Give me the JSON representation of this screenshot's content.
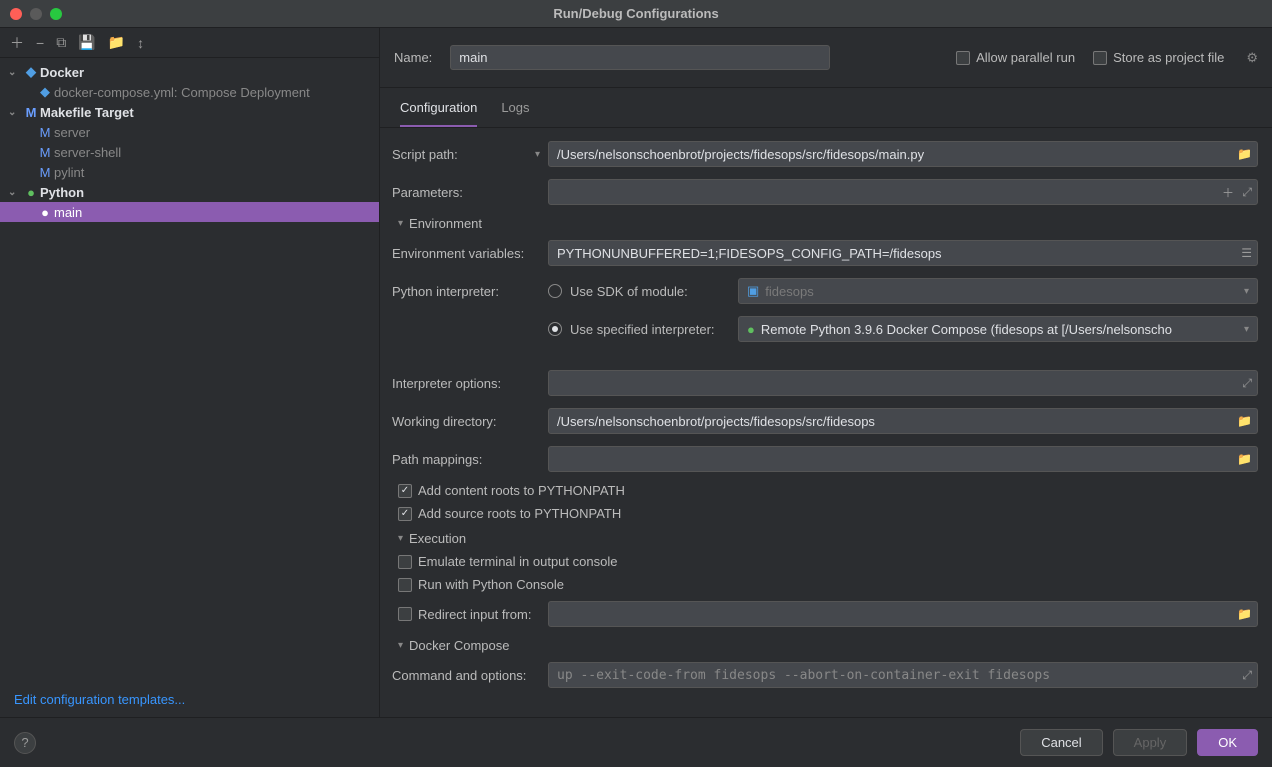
{
  "window": {
    "title": "Run/Debug Configurations"
  },
  "sidebar": {
    "groups": [
      {
        "name": "Docker",
        "icon": "docker",
        "children": [
          {
            "name": "docker-compose.yml: Compose Deployment",
            "icon": "compose"
          }
        ]
      },
      {
        "name": "Makefile Target",
        "icon": "M",
        "children": [
          {
            "name": "server",
            "icon": "M"
          },
          {
            "name": "server-shell",
            "icon": "M"
          },
          {
            "name": "pylint",
            "icon": "M"
          }
        ]
      },
      {
        "name": "Python",
        "icon": "python",
        "children": [
          {
            "name": "main",
            "icon": "python",
            "selected": true
          }
        ]
      }
    ],
    "edit_templates": "Edit configuration templates..."
  },
  "header": {
    "name_label": "Name:",
    "name_value": "main",
    "allow_parallel": "Allow parallel run",
    "store_as_project": "Store as project file"
  },
  "tabs": {
    "configuration": "Configuration",
    "logs": "Logs"
  },
  "form": {
    "script_path": {
      "label": "Script path:",
      "value": "/Users/nelsonschoenbrot/projects/fidesops/src/fidesops/main.py"
    },
    "parameters": {
      "label": "Parameters:",
      "value": ""
    },
    "env_section": "Environment",
    "env_vars": {
      "label": "Environment variables:",
      "value": "PYTHONUNBUFFERED=1;FIDESOPS_CONFIG_PATH=/fidesops"
    },
    "interpreter_label": "Python interpreter:",
    "sdk_module": {
      "label": "Use SDK of module:",
      "value": "fidesops"
    },
    "specified": {
      "label": "Use specified interpreter:",
      "value": "Remote Python 3.9.6 Docker Compose (fidesops at [/Users/nelsonscho"
    },
    "interp_opts": {
      "label": "Interpreter options:",
      "value": ""
    },
    "workdir": {
      "label": "Working directory:",
      "value": "/Users/nelsonschoenbrot/projects/fidesops/src/fidesops"
    },
    "pathmap": {
      "label": "Path mappings:",
      "value": ""
    },
    "add_content": "Add content roots to PYTHONPATH",
    "add_source": "Add source roots to PYTHONPATH",
    "exec_section": "Execution",
    "emulate": "Emulate terminal in output console",
    "pyconsole": "Run with Python Console",
    "redirect": {
      "label": "Redirect input from:",
      "value": ""
    },
    "docker_section": "Docker Compose",
    "cmd_opts": {
      "label": "Command and options:",
      "value": "up --exit-code-from fidesops --abort-on-container-exit fidesops"
    }
  },
  "footer": {
    "cancel": "Cancel",
    "apply": "Apply",
    "ok": "OK"
  }
}
